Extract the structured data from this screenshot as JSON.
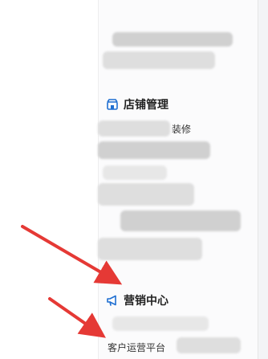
{
  "sidebar": {
    "sections": [
      {
        "title": "店铺管理",
        "icon": "store-icon",
        "items": [
          "装修"
        ]
      },
      {
        "title": "营销中心",
        "icon": "megaphone-icon",
        "items": [
          "客户运营平台"
        ]
      }
    ]
  },
  "colors": {
    "accent": "#1f6fd1",
    "arrow": "#e53935"
  }
}
